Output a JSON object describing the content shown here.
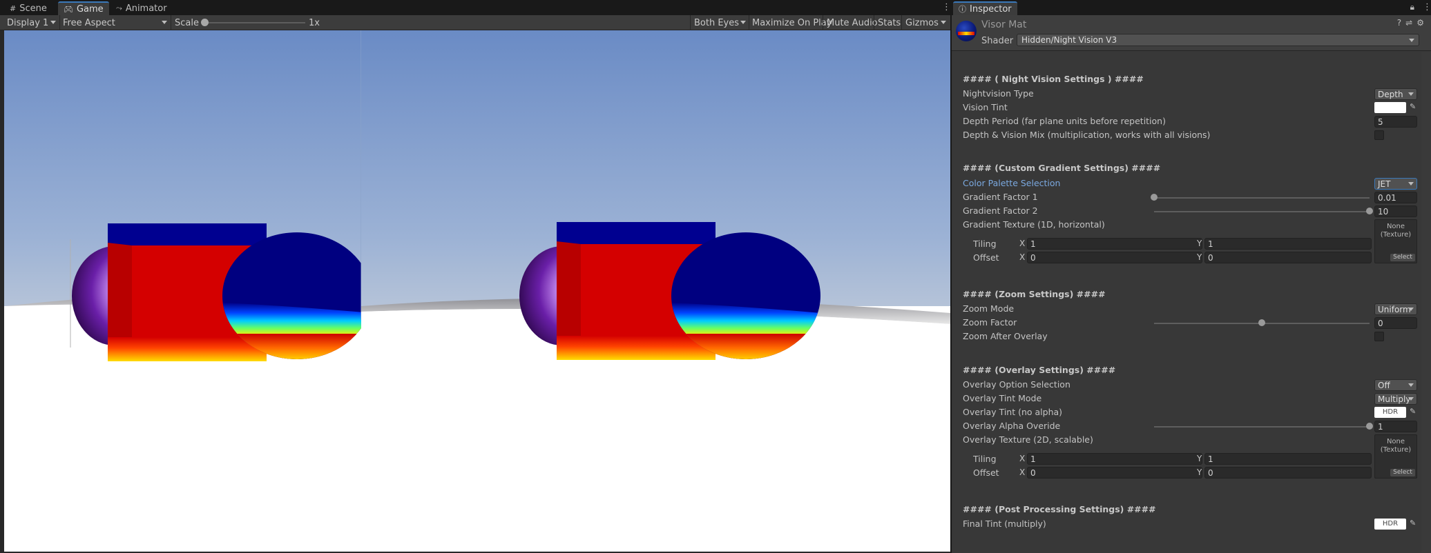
{
  "game_window": {
    "tabs": [
      {
        "label": "Scene",
        "icon": "grid-icon"
      },
      {
        "label": "Game",
        "icon": "gamepad-icon"
      },
      {
        "label": "Animator",
        "icon": "animator-icon"
      }
    ],
    "toolbar": {
      "display": "Display 1",
      "aspect": "Free Aspect",
      "scale_label": "Scale",
      "scale_value": "1x",
      "eyes": "Both Eyes",
      "maximize": "Maximize On Play",
      "mute": "Mute Audio",
      "stats": "Stats",
      "gizmos": "Gizmos"
    }
  },
  "inspector": {
    "tab_label": "Inspector",
    "material_name": "Visor Mat",
    "shader_label": "Shader",
    "shader_value": "Hidden/Night Vision V3",
    "sections": {
      "night_vision": {
        "title": "#### ( Night Vision Settings ) ####",
        "type_label": "Nightvision Type",
        "type_value": "Depth",
        "tint_label": "Vision Tint",
        "depth_period_label": "Depth Period (far plane units before repetition)",
        "depth_period_value": "5",
        "mix_label": "Depth & Vision Mix (multiplication, works with all visions)"
      },
      "gradient": {
        "title": "#### (Custom Gradient Settings) ####",
        "palette_label": "Color Palette Selection",
        "palette_value": "JET",
        "factor1_label": "Gradient Factor 1",
        "factor1_value": "0.01",
        "factor1_fraction": 0.0,
        "factor2_label": "Gradient Factor 2",
        "factor2_value": "10",
        "factor2_fraction": 1.0,
        "texture_label": "Gradient Texture (1D, horizontal)",
        "texture_none": "None",
        "texture_type": "(Texture)",
        "select_label": "Select",
        "tiling_label": "Tiling",
        "offset_label": "Offset",
        "tiling_x": "1",
        "tiling_y": "1",
        "offset_x": "0",
        "offset_y": "0"
      },
      "zoom": {
        "title": "#### (Zoom Settings) ####",
        "mode_label": "Zoom Mode",
        "mode_value": "Uniform",
        "factor_label": "Zoom Factor",
        "factor_value": "0",
        "factor_fraction": 0.5,
        "after_overlay_label": "Zoom After Overlay"
      },
      "overlay": {
        "title": "#### (Overlay Settings) ####",
        "option_label": "Overlay Option Selection",
        "option_value": "Off",
        "tint_mode_label": "Overlay Tint Mode",
        "tint_mode_value": "Multiply",
        "tint_label": "Overlay Tint (no alpha)",
        "hdr_label": "HDR",
        "alpha_label": "Overlay Alpha Overide",
        "alpha_value": "1",
        "alpha_fraction": 1.0,
        "texture_label": "Overlay Texture (2D, scalable)",
        "texture_none": "None",
        "texture_type": "(Texture)",
        "select_label": "Select",
        "tiling_label": "Tiling",
        "offset_label": "Offset",
        "tiling_x": "1",
        "tiling_y": "1",
        "offset_x": "0",
        "offset_y": "0"
      },
      "post": {
        "title": "#### (Post Processing Settings) ####",
        "final_tint_label": "Final Tint (multiply)",
        "hdr_label": "HDR"
      }
    },
    "axis": {
      "x": "X",
      "y": "Y"
    }
  },
  "colors": {
    "accent": "#3a79bb",
    "palette_label": "#7ba9e0",
    "sky_top": "#6b8cc6",
    "sky_bottom": "#a8bcd8",
    "red": "#d40000",
    "navy": "#000080",
    "purple": "#6a1fa8"
  }
}
